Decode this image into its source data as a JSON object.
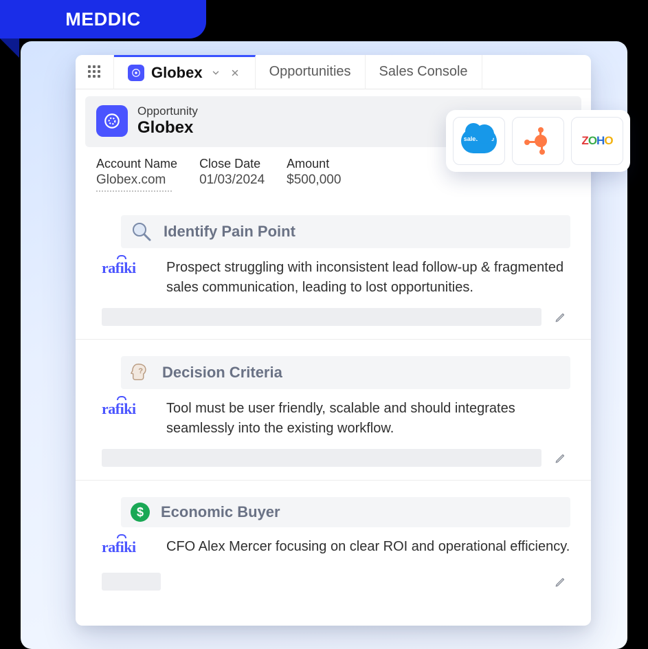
{
  "badge": {
    "label": "MEDDIC"
  },
  "tabs": {
    "active": "Globex",
    "others": [
      "Opportunities",
      "Sales Console"
    ]
  },
  "header": {
    "type_label": "Opportunity",
    "name": "Globex"
  },
  "integrations": [
    "salesforce",
    "hubspot",
    "zoho"
  ],
  "meta": {
    "account_label": "Account Name",
    "account_value": "Globex.com",
    "close_label": "Close Date",
    "close_value": "01/03/2024",
    "amount_label": "Amount",
    "amount_value": "$500,000"
  },
  "sections": [
    {
      "icon": "search",
      "title": "Identify Pain Point",
      "brand": "rafiki",
      "body": "Prospect struggling with inconsistent lead follow-up & fragmented sales communication, leading to lost opportunities."
    },
    {
      "icon": "head",
      "title": "Decision Criteria",
      "brand": "rafiki",
      "body": "Tool must be user friendly, scalable and should integrates seamlessly into the existing workflow."
    },
    {
      "icon": "dollar",
      "title": "Economic Buyer",
      "brand": "rafiki",
      "body": "CFO Alex Mercer focusing on clear ROI and operational efficiency."
    }
  ]
}
